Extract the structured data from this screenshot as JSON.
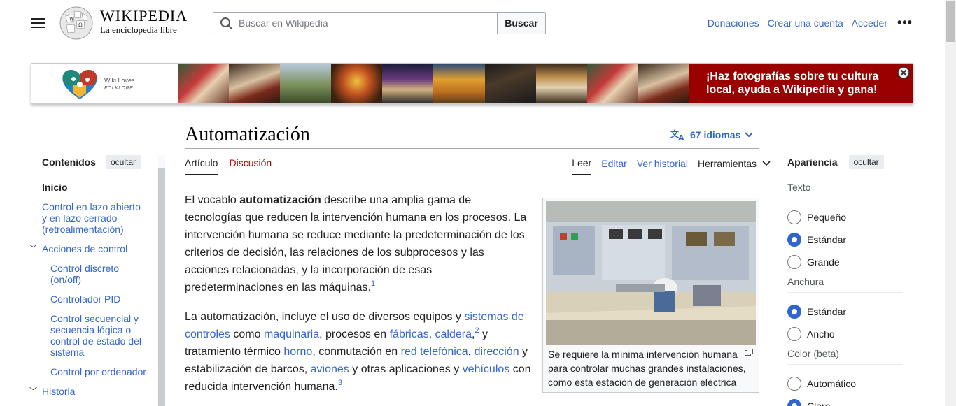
{
  "header": {
    "wordmark": "WIKIPEDIA",
    "tagline": "La enciclopedia libre",
    "search_placeholder": "Buscar en Wikipedia",
    "search_button": "Buscar",
    "links": [
      "Donaciones",
      "Crear una cuenta",
      "Acceder"
    ],
    "more": "•••"
  },
  "banner": {
    "logo_wiki_loves": "Wiki Loves",
    "logo_folklore": "FOLKLORE",
    "cta_line1": "¡Haz fotografías sobre tu cultura",
    "cta_line2": "local, ayuda a Wikipedia y gana!",
    "accent": "#990000"
  },
  "toc": {
    "title": "Contenidos",
    "hide": "ocultar",
    "items": [
      {
        "label": "Inicio"
      },
      {
        "label": "Control en lazo abierto y en lazo cerrado (retroalimentación)"
      },
      {
        "label": "Acciones de control"
      },
      {
        "label": "Control discreto (on/off)"
      },
      {
        "label": "Controlador PID"
      },
      {
        "label": "Control secuencial y secuencia lógica o control de estado del sistema"
      },
      {
        "label": "Control por ordenador"
      },
      {
        "label": "Historia"
      }
    ]
  },
  "article": {
    "title": "Automatización",
    "languages": "67 idiomas",
    "tabs_left": [
      "Artículo",
      "Discusión"
    ],
    "tabs_right": [
      "Leer",
      "Editar",
      "Ver historial",
      "Herramientas"
    ],
    "p1": {
      "before": "El vocablo ",
      "bold": "automatización",
      "after": " describe una amplia gama de tecnologías que reducen la intervención humana en los procesos. La intervención humana se reduce mediante la predeterminación de los criterios de decisión, las relaciones de los subprocesos y las acciones relacionadas, y la incorporación de esas predeterminaciones en las máquinas.",
      "ref": "1"
    },
    "p2": {
      "t1": "La automatización, incluye el uso de diversos equipos y ",
      "l1": "sistemas de controles",
      "t2": " como ",
      "l2": "maquinaria",
      "t3": ", procesos en ",
      "l3": "fábricas",
      "t4": ", ",
      "l4": "caldera",
      "t5": ",",
      "ref2": "2",
      "t6": "  y tratamiento térmico ",
      "l5": "horno",
      "t7": ", conmutación en ",
      "l6": "red telefónica",
      "t8": ", ",
      "l7": "dirección",
      "t9": " y estabilización de barcos, ",
      "l8": "aviones",
      "t10": " y otras aplicaciones y ",
      "l9": "vehículos",
      "t11": " con reducida intervención humana.",
      "ref3": "3"
    },
    "image_caption": "Se requiere la mínima intervención humana para controlar muchas grandes instalaciones, como esta estación de generación eléctrica"
  },
  "appearance": {
    "title": "Apariencia",
    "hide": "ocultar",
    "text_label": "Texto",
    "text_options": [
      "Pequeño",
      "Estándar",
      "Grande"
    ],
    "text_selected": "Estándar",
    "width_label": "Anchura",
    "width_options": [
      "Estándar",
      "Ancho"
    ],
    "width_selected": "Estándar",
    "color_label": "Color (beta)",
    "color_options": [
      "Automático",
      "Claro"
    ],
    "color_selected": "Claro"
  }
}
